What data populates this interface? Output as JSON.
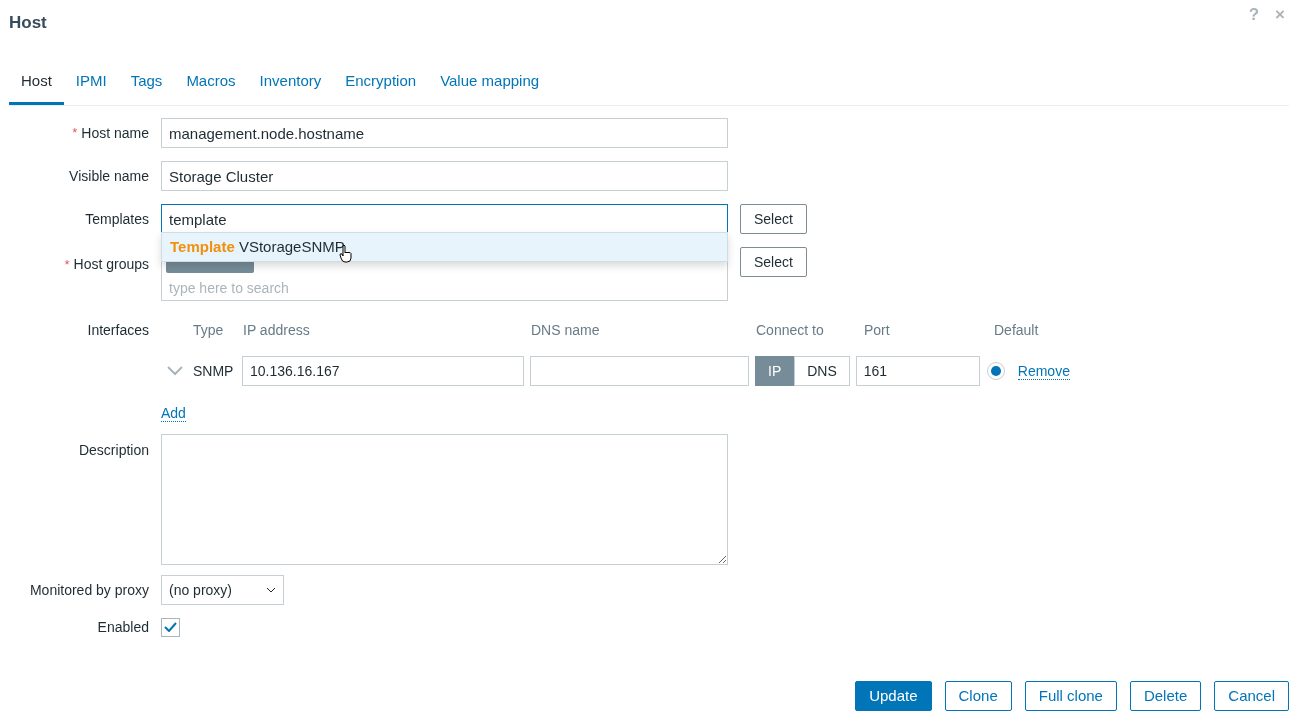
{
  "window": {
    "title": "Host",
    "help": "?",
    "close": "×"
  },
  "tabs": [
    {
      "label": "Host",
      "selected": true
    },
    {
      "label": "IPMI",
      "selected": false
    },
    {
      "label": "Tags",
      "selected": false
    },
    {
      "label": "Macros",
      "selected": false
    },
    {
      "label": "Inventory",
      "selected": false
    },
    {
      "label": "Encryption",
      "selected": false
    },
    {
      "label": "Value mapping",
      "selected": false
    }
  ],
  "form": {
    "host_name": {
      "label": "Host name",
      "required_mark": "*",
      "value": "management.node.hostname"
    },
    "visible_name": {
      "label": "Visible name",
      "value": "Storage Cluster"
    },
    "templates": {
      "label": "Templates",
      "value": "template",
      "button": "Select",
      "suggestion": {
        "match": "Template",
        "rest": " VStorageSNMP"
      }
    },
    "host_groups": {
      "label": "Host groups",
      "required_mark": "*",
      "placeholder": "type here to search",
      "button": "Select"
    },
    "interfaces": {
      "label": "Interfaces",
      "columns": [
        "Type",
        "IP address",
        "DNS name",
        "Connect to",
        "Port",
        "Default"
      ],
      "rows": [
        {
          "type": "SNMP",
          "ip": "10.136.16.167",
          "connect": [
            {
              "label": "IP",
              "selected": true
            },
            {
              "label": "DNS",
              "selected": false
            }
          ],
          "port": "161",
          "default": true,
          "remove": "Remove"
        }
      ],
      "add": "Add"
    },
    "description": {
      "label": "Description"
    },
    "proxy": {
      "label": "Monitored by proxy",
      "value": "(no proxy)"
    },
    "enabled": {
      "label": "Enabled",
      "checked": true
    }
  },
  "buttons": [
    {
      "label": "Update",
      "primary": true
    },
    {
      "label": "Clone",
      "primary": false
    },
    {
      "label": "Full clone",
      "primary": false
    },
    {
      "label": "Delete",
      "primary": false
    },
    {
      "label": "Cancel",
      "primary": false
    }
  ]
}
